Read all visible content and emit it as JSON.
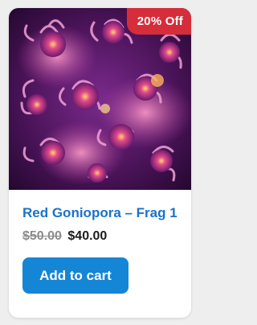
{
  "badge": {
    "label": "20% Off",
    "color": "#d62d3b"
  },
  "product": {
    "title": "Red Goniopora – Frag 1",
    "price_old": "$50.00",
    "price_new": "$40.00",
    "image_subject": "coral-polyps-photo"
  },
  "actions": {
    "add_to_cart_label": "Add to cart",
    "button_color": "#1586d6"
  },
  "colors": {
    "title": "#1a73c8",
    "background": "#eeeeee"
  }
}
